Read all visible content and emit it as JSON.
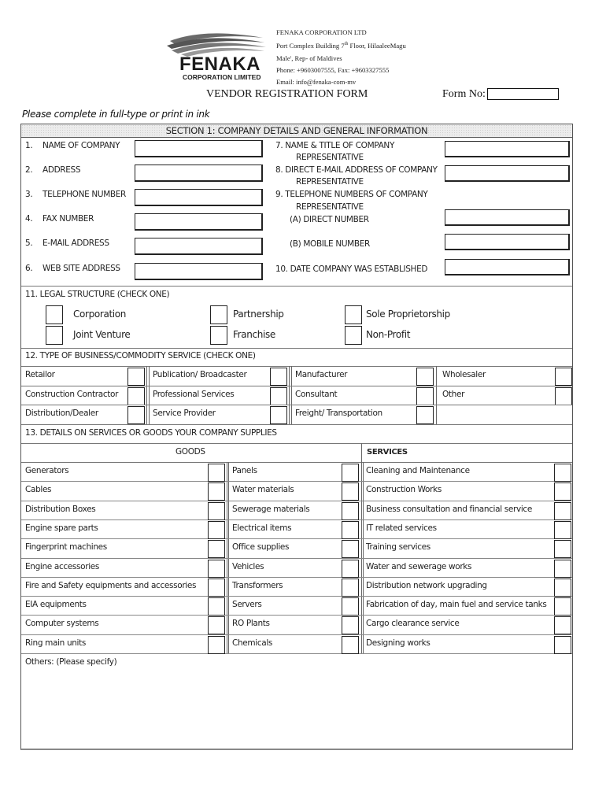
{
  "header": {
    "logo": {
      "icon": "fenaka-wave-logo",
      "word": "FENAKA",
      "sub": "CORPORATION LIMITED"
    },
    "company_info": {
      "name": "FENAKA CORPORATION LTD",
      "address_line1_pre": "Port Complex Building 7",
      "address_line1_sup": "th",
      "address_line1_post": " Floor, HilaaleeMagu",
      "address_line2": "Male', Rep- of Maldives",
      "phone": "Phone: +9603007555, Fax: +9603327555",
      "email": "Email: info@fenaka-com-mv"
    },
    "form_title": "VENDOR REGISTRATION FORM",
    "form_no_label": "Form No:",
    "form_no_value": ""
  },
  "instruction": "Please complete in full-type or print in ink",
  "section1": {
    "title": "SECTION 1: COMPANY DETAILS AND GENERAL INFORMATION",
    "left_fields": [
      {
        "num": "1.",
        "label": "NAME OF COMPANY",
        "value": ""
      },
      {
        "num": "2.",
        "label": "ADDRESS",
        "value": ""
      },
      {
        "num": "3.",
        "label": "TELEPHONE NUMBER",
        "value": ""
      },
      {
        "num": "4.",
        "label": "FAX NUMBER",
        "value": ""
      },
      {
        "num": "5.",
        "label": "E-MAIL ADDRESS",
        "value": ""
      },
      {
        "num": "6.",
        "label": "WEB SITE ADDRESS",
        "value": ""
      }
    ],
    "right_fields": {
      "f7_line1": "7. NAME & TITLE OF COMPANY",
      "f7_line2": "REPRESENTATIVE",
      "f8_line1": "8. DIRECT E-MAIL ADDRESS OF COMPANY",
      "f8_line2": "REPRESENTATIVE",
      "f9_line1": "9. TELEPHONE NUMBERS OF COMPANY",
      "f9_line2": "REPRESENTATIVE",
      "f9a": "(A)   DIRECT NUMBER",
      "f9b": "(B)   MOBILE NUMBER",
      "f10": "10. DATE COMPANY WAS ESTABLISHED"
    },
    "legal_structure": {
      "title": "11. LEGAL STRUCTURE (CHECK ONE)",
      "options": [
        "Corporation",
        "Partnership",
        "Sole Proprietorship",
        "Joint Venture",
        "Franchise",
        "Non-Profit"
      ]
    },
    "business_type": {
      "title": "12. TYPE OF BUSINESS/COMMODITY SERVICE (CHECK ONE)",
      "rows": [
        [
          "Retailor",
          "Publication/ Broadcaster",
          "Manufacturer",
          "Wholesaler"
        ],
        [
          "Construction Contractor",
          "Professional Services",
          "Consultant",
          "Other"
        ],
        [
          "Distribution/Dealer",
          "Service Provider",
          "Freight/ Transportation",
          ""
        ]
      ]
    },
    "supplies": {
      "title": "13. DETAILS ON SERVICES OR GOODS YOUR COMPANY SUPPLIES",
      "goods_header": "GOODS",
      "services_header": "SERVICES",
      "goods_col1": [
        "Generators",
        "Cables",
        "Distribution Boxes",
        "Engine spare parts",
        "Fingerprint machines",
        "Engine accessories",
        "Fire and Safety equipments and accessories",
        "EIA equipments",
        "Computer systems",
        "Ring main units"
      ],
      "goods_col2": [
        "Panels",
        "Water materials",
        "Sewerage materials",
        "Electrical items",
        "Office supplies",
        "Vehicles",
        "Transformers",
        "Servers",
        "RO Plants",
        "Chemicals"
      ],
      "services": [
        "Cleaning and Maintenance",
        "Construction Works",
        "Business consultation and financial service",
        "IT related services",
        "Training services",
        "Water and sewerage works",
        "Distribution network upgrading",
        "Fabrication of day, main fuel and service tanks",
        "Cargo clearance service",
        "Designing works"
      ],
      "others_label": "Others: (Please specify)",
      "others_value": ""
    }
  }
}
